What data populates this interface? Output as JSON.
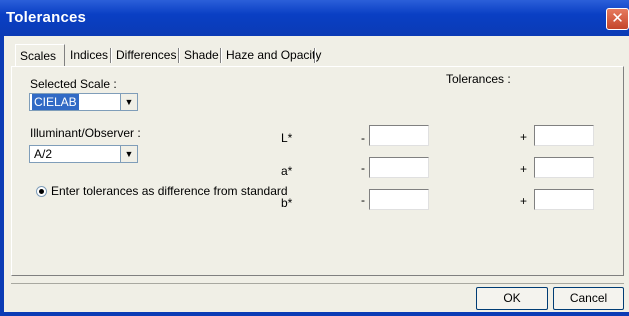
{
  "window": {
    "title": "Tolerances",
    "close_glyph": "✕"
  },
  "tabs": [
    {
      "label": "Scales",
      "active": true
    },
    {
      "label": "Indices",
      "active": false
    },
    {
      "label": "Differences",
      "active": false
    },
    {
      "label": "Shade",
      "active": false
    },
    {
      "label": "Haze and Opacity",
      "active": false
    }
  ],
  "scales": {
    "selected_scale_label": "Selected Scale :",
    "selected_scale_value": "CIELAB",
    "illuminant_label": "Illuminant/Observer :",
    "illuminant_value": "A/2",
    "option_label": "Enter tolerances as difference from standard",
    "option_checked": true,
    "tolerances_heading": "Tolerances :",
    "rows": [
      {
        "label": "L*",
        "minus": "-",
        "plus": "+",
        "minus_value": "",
        "plus_value": ""
      },
      {
        "label": "a*",
        "minus": "-",
        "plus": "+",
        "minus_value": "",
        "plus_value": ""
      },
      {
        "label": "b*",
        "minus": "-",
        "plus": "+",
        "minus_value": "",
        "plus_value": ""
      }
    ],
    "dropdown_glyph": "▼"
  },
  "buttons": {
    "ok": "OK",
    "cancel": "Cancel"
  }
}
